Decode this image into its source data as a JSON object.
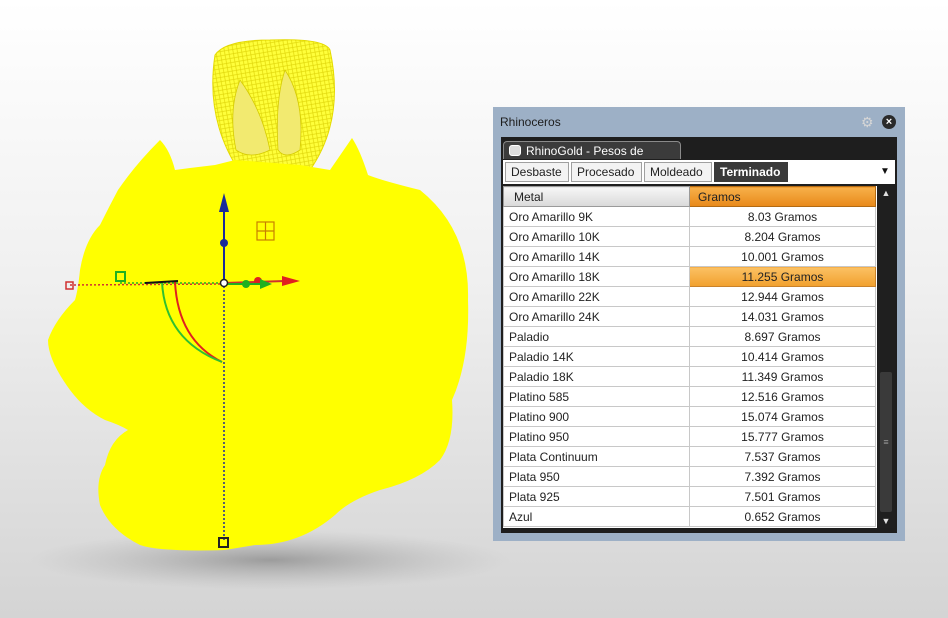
{
  "window": {
    "title": "Rhinoceros"
  },
  "icons": {
    "gear": "gear-icon",
    "close": "close-icon",
    "rhino": "rhino-icon"
  },
  "plugin_tab": {
    "label": "RhinoGold - Pesos de metales"
  },
  "tabs": [
    {
      "label": "Desbaste",
      "active": false
    },
    {
      "label": "Procesado",
      "active": false
    },
    {
      "label": "Moldeado",
      "active": false
    },
    {
      "label": "Terminado",
      "active": true
    }
  ],
  "table": {
    "headers": {
      "metal": "Metal",
      "gramos": "Gramos"
    },
    "selected_row": "Oro Amarillo 18K",
    "rows": [
      {
        "metal": "Oro Amarillo 9K",
        "gramos": "8.03 Gramos"
      },
      {
        "metal": "Oro Amarillo 10K",
        "gramos": "8.204 Gramos"
      },
      {
        "metal": "Oro Amarillo 14K",
        "gramos": "10.001 Gramos"
      },
      {
        "metal": "Oro Amarillo 18K",
        "gramos": "11.255 Gramos"
      },
      {
        "metal": "Oro Amarillo 22K",
        "gramos": "12.944 Gramos"
      },
      {
        "metal": "Oro Amarillo 24K",
        "gramos": "14.031 Gramos"
      },
      {
        "metal": "Paladio",
        "gramos": "8.697 Gramos"
      },
      {
        "metal": "Paladio 14K",
        "gramos": "10.414 Gramos"
      },
      {
        "metal": "Paladio 18K",
        "gramos": "11.349 Gramos"
      },
      {
        "metal": "Platino 585",
        "gramos": "12.516 Gramos"
      },
      {
        "metal": "Platino 900",
        "gramos": "15.074 Gramos"
      },
      {
        "metal": "Platino 950",
        "gramos": "15.777 Gramos"
      },
      {
        "metal": "Plata Continuum",
        "gramos": "7.537 Gramos"
      },
      {
        "metal": "Plata 950",
        "gramos": "7.392 Gramos"
      },
      {
        "metal": "Plata 925",
        "gramos": "7.501 Gramos"
      },
      {
        "metal": "Azul",
        "gramos": "0.652 Gramos"
      }
    ]
  },
  "colors": {
    "model": "#ffff00",
    "accent": "#f0a030",
    "panel_frame": "#9db0c6",
    "gumball_x": "#e02020",
    "gumball_y": "#20b020",
    "gumball_z": "#1a2a9a"
  }
}
